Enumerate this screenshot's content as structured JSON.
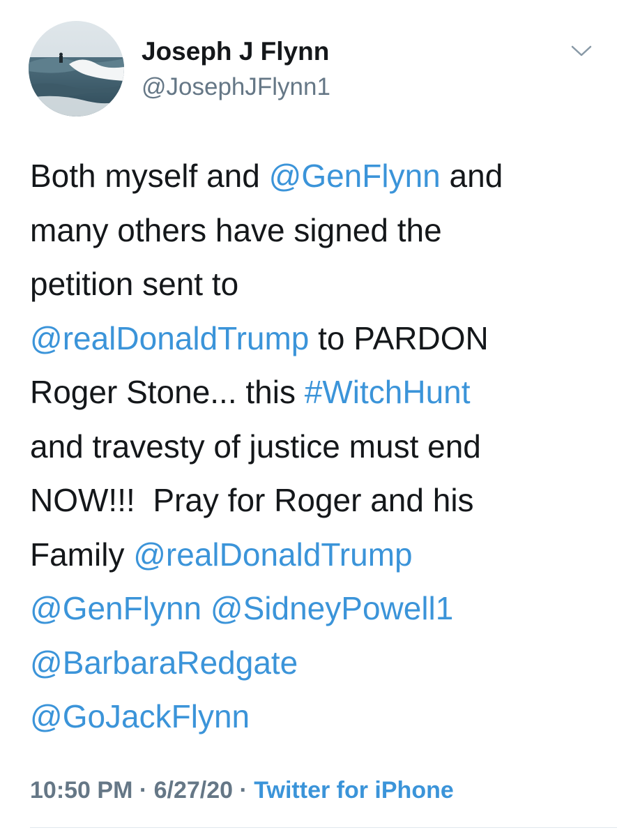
{
  "user": {
    "display_name": "Joseph J Flynn",
    "handle": "@JosephJFlynn1"
  },
  "tweet": {
    "lines": [
      [
        {
          "t": "Both myself and "
        },
        {
          "t": "@GenFlynn",
          "link": true
        },
        {
          "t": " and"
        }
      ],
      [
        {
          "t": "many others have signed the"
        }
      ],
      [
        {
          "t": "petition sent to"
        }
      ],
      [
        {
          "t": "@realDonaldTrump",
          "link": true
        },
        {
          "t": " to PARDON"
        }
      ],
      [
        {
          "t": "Roger Stone... this "
        },
        {
          "t": "#WitchHunt",
          "link": true
        }
      ],
      [
        {
          "t": "and travesty of justice must end"
        }
      ],
      [
        {
          "t": "NOW!!!  Pray for Roger and his"
        }
      ],
      [
        {
          "t": "Family "
        },
        {
          "t": "@realDonaldTrump",
          "link": true
        }
      ],
      [
        {
          "t": "@GenFlynn",
          "link": true
        },
        {
          "t": " "
        },
        {
          "t": "@SidneyPowell1",
          "link": true
        }
      ],
      [
        {
          "t": "@BarbaraRedgate",
          "link": true
        }
      ],
      [
        {
          "t": "@GoJackFlynn",
          "link": true
        }
      ]
    ]
  },
  "meta": {
    "time": "10:50 PM",
    "separator": " · ",
    "date": "6/27/20",
    "source": "Twitter for iPhone"
  },
  "icons": {
    "menu": "chevron-down-icon"
  },
  "colors": {
    "link": "#3b94d9",
    "secondary_text": "#657786",
    "primary_text": "#14171a"
  }
}
